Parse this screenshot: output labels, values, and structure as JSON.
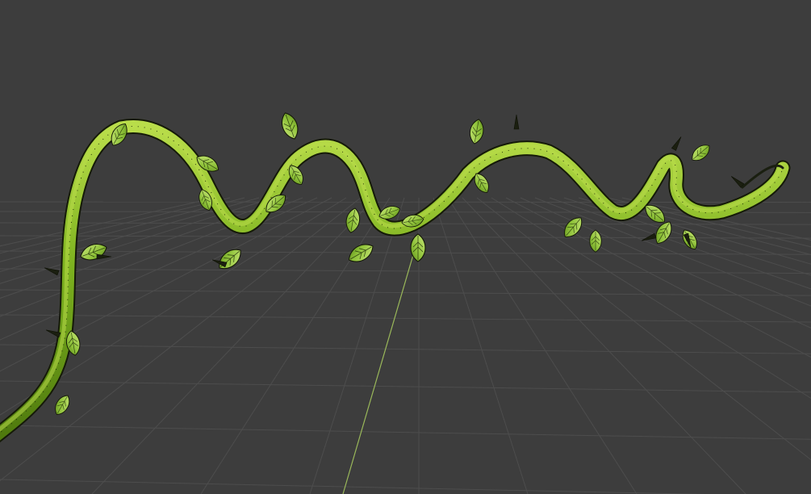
{
  "viewport": {
    "background_color": "#3d3d3d",
    "grid_color": "#4d4d4d",
    "y_axis_color": "#9ab85a"
  },
  "model": {
    "object": "vine",
    "shading": "solid-with-wireframe",
    "stem_color_dark": "#4f7a0e",
    "stem_color_mid": "#7db21f",
    "stem_color_light": "#b9dd4a",
    "leaf_color": "#8fc23a",
    "leaf_light_color": "#c7e676",
    "wire_color": "#1a2208"
  }
}
